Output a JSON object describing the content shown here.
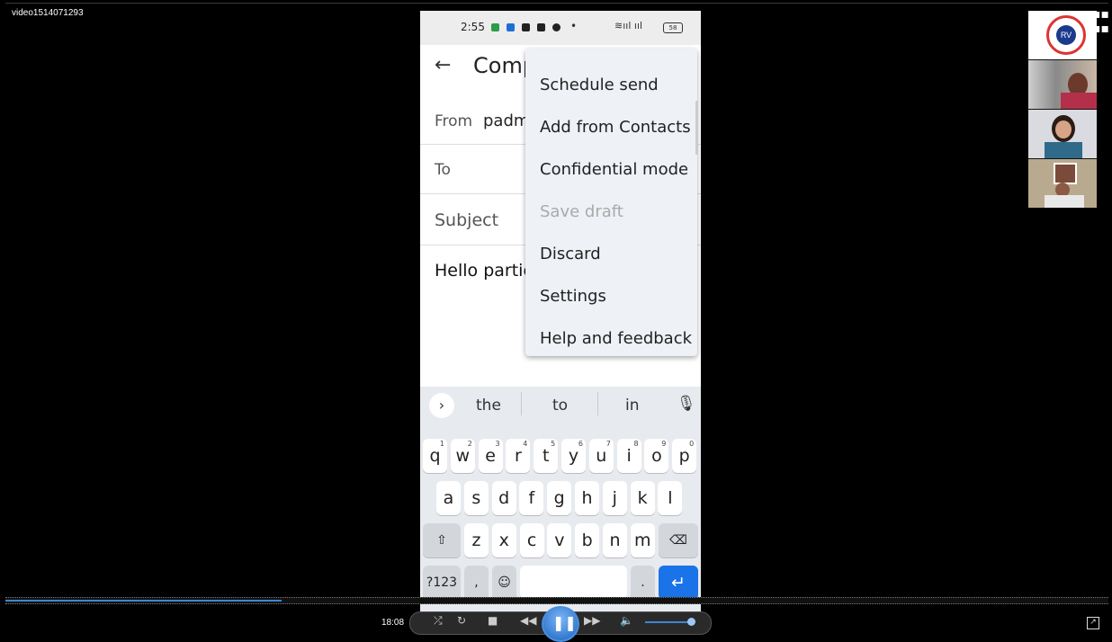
{
  "window": {
    "title": "video1514071293"
  },
  "phone": {
    "status_time": "2:55",
    "status_battery": "58",
    "compose": {
      "title": "Comp",
      "from_label": "From",
      "from_value": "padm",
      "to_label": "To",
      "subject_label": "Subject",
      "body": "Hello partic"
    },
    "menu": {
      "items": [
        {
          "label": "Schedule send"
        },
        {
          "label": "Add from Contacts"
        },
        {
          "label": "Confidential mode"
        },
        {
          "label": "Save draft",
          "disabled": true
        },
        {
          "label": "Discard"
        },
        {
          "label": "Settings"
        },
        {
          "label": "Help and feedback"
        }
      ]
    },
    "keyboard": {
      "suggestions": [
        "the",
        "to",
        "in"
      ],
      "row1": [
        "q",
        "w",
        "e",
        "r",
        "t",
        "y",
        "u",
        "i",
        "o",
        "p"
      ],
      "row1_hints": [
        "1",
        "2",
        "3",
        "4",
        "5",
        "6",
        "7",
        "8",
        "9",
        "0"
      ],
      "row2": [
        "a",
        "s",
        "d",
        "f",
        "g",
        "h",
        "j",
        "k",
        "l"
      ],
      "row3": [
        "z",
        "x",
        "c",
        "v",
        "b",
        "n",
        "m"
      ],
      "symbols_key": "?123",
      "comma_key": ",",
      "period_key": "."
    }
  },
  "player": {
    "time": "18:08",
    "progress": 0.25,
    "volume": 0.9
  },
  "colors": {
    "accent": "#3d86d4",
    "enter_key": "#1a73e8"
  }
}
